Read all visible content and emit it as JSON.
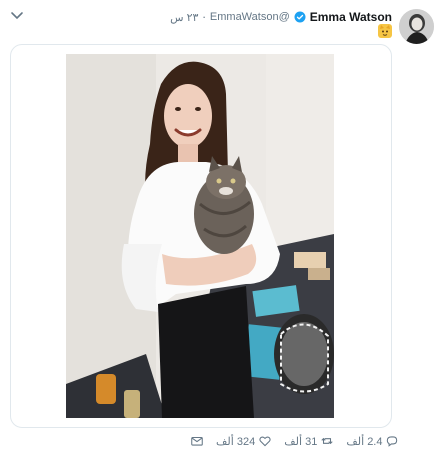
{
  "tweet": {
    "name": "Emma Watson",
    "handle": "@EmmaWatson",
    "separator": "·",
    "time": "٢٣ س",
    "text_emoji": "cat-face-emoji",
    "photo_description_icon": "photo"
  },
  "actions": {
    "reply_count": "2.4 ألف",
    "retweet_count": "31 ألف",
    "like_count": "324 ألف",
    "message_icon": "envelope-icon"
  },
  "colors": {
    "verified": "#1da1f2",
    "muted": "#657786",
    "border": "#e1e8ed"
  }
}
